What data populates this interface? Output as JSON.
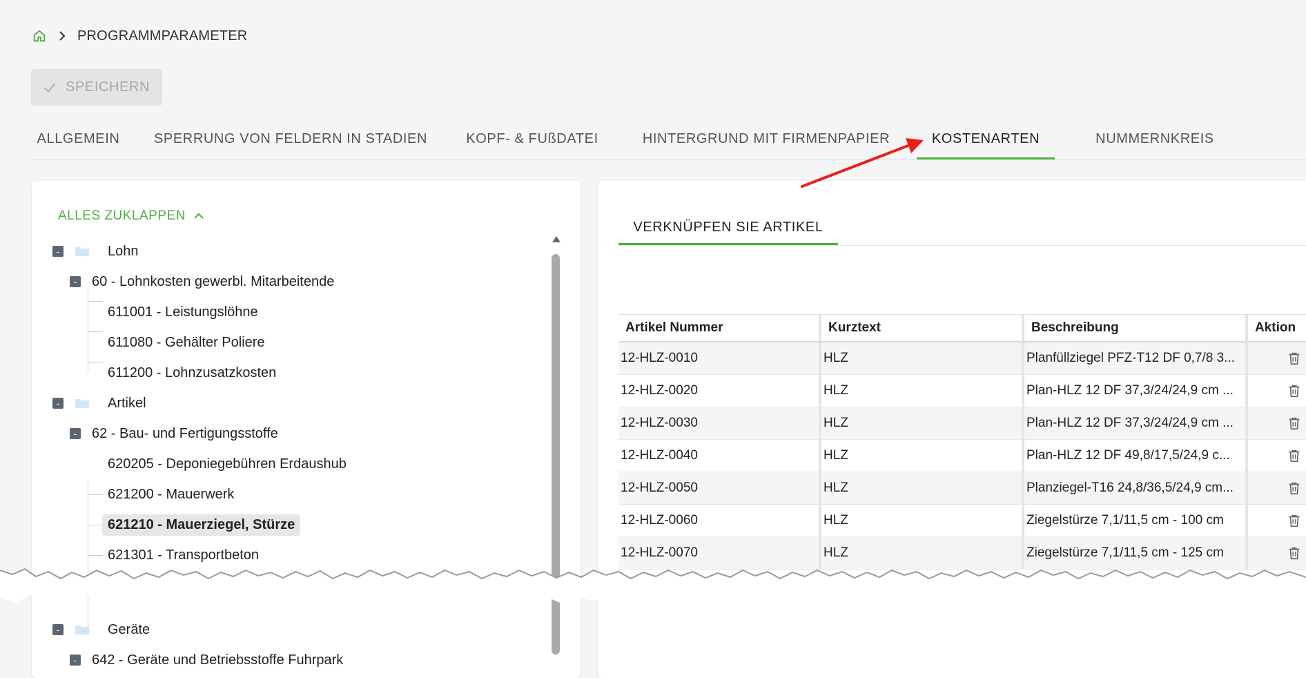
{
  "breadcrumb": {
    "home_icon": "home-icon",
    "separator_icon": "chevron-right-icon",
    "current": "PROGRAMMPARAMETER"
  },
  "toolbar": {
    "save_label": "SPEICHERN",
    "save_icon": "check-icon"
  },
  "tabs": [
    {
      "label": "ALLGEMEIN",
      "active": false
    },
    {
      "label": "SPERRUNG VON FELDERN IN STADIEN",
      "active": false
    },
    {
      "label": "KOPF- & FUßDATEI",
      "active": false
    },
    {
      "label": "HINTERGRUND MIT FIRMENPAPIER",
      "active": false
    },
    {
      "label": "KOSTENARTEN",
      "active": true
    },
    {
      "label": "NUMMERNKREIS",
      "active": false
    }
  ],
  "annotation": {
    "arrow_color": "#e8201c"
  },
  "tree_panel": {
    "collapse_all_label": "ALLES ZUKLAPPEN",
    "toggle_symbol": "-",
    "nodes": [
      {
        "level": 0,
        "label": "Lohn",
        "type": "folder"
      },
      {
        "level": 1,
        "label": "60 - Lohnkosten gewerbl. Mitarbeitende",
        "type": "group"
      },
      {
        "level": 2,
        "label": "611001 - Leistungslöhne",
        "type": "leaf"
      },
      {
        "level": 2,
        "label": "611080 - Gehälter Poliere",
        "type": "leaf"
      },
      {
        "level": 2,
        "label": "611200 - Lohnzusatzkosten",
        "type": "leaf"
      },
      {
        "level": 0,
        "label": "Artikel",
        "type": "folder"
      },
      {
        "level": 1,
        "label": "62 - Bau- und Fertigungsstoffe",
        "type": "group"
      },
      {
        "level": 2,
        "label": "620205 - Deponiegebühren Erdaushub",
        "type": "leaf"
      },
      {
        "level": 2,
        "label": "621200 - Mauerwerk",
        "type": "leaf"
      },
      {
        "level": 2,
        "label": "621210 - Mauerziegel, Stürze",
        "type": "leaf",
        "selected": true
      },
      {
        "level": 2,
        "label": "621301 - Transportbeton",
        "type": "leaf"
      },
      {
        "level": 0,
        "label": "Geräte",
        "type": "folder"
      },
      {
        "level": 1,
        "label": "642 - Geräte und Betriebsstoffe Fuhrpark",
        "type": "group"
      }
    ]
  },
  "articles_panel": {
    "subtab_label": "VERKNÜPFEN SIE ARTIKEL",
    "columns": [
      "Artikel Nummer",
      "Kurztext",
      "Beschreibung",
      "Aktion"
    ],
    "rows": [
      {
        "nummer": "12-HLZ-0010",
        "kurztext": "HLZ",
        "beschreibung": "Planfüllziegel PFZ-T12 DF 0,7/8 3..."
      },
      {
        "nummer": "12-HLZ-0020",
        "kurztext": "HLZ",
        "beschreibung": "Plan-HLZ 12 DF 37,3/24/24,9 cm ..."
      },
      {
        "nummer": "12-HLZ-0030",
        "kurztext": "HLZ",
        "beschreibung": "Plan-HLZ 12 DF 37,3/24/24,9 cm ..."
      },
      {
        "nummer": "12-HLZ-0040",
        "kurztext": "HLZ",
        "beschreibung": "Plan-HLZ 12 DF 49,8/17,5/24,9 c..."
      },
      {
        "nummer": "12-HLZ-0050",
        "kurztext": "HLZ",
        "beschreibung": "Planziegel-T16 24,8/36,5/24,9 cm..."
      },
      {
        "nummer": "12-HLZ-0060",
        "kurztext": "HLZ",
        "beschreibung": "Ziegelstürze 7,1/11,5 cm - 100 cm"
      },
      {
        "nummer": "12-HLZ-0070",
        "kurztext": "HLZ",
        "beschreibung": "Ziegelstürze 7,1/11,5 cm - 125 cm"
      }
    ],
    "action_icon": "trash-icon"
  },
  "colors": {
    "accent": "#4cae3d",
    "background": "#f5f5f5",
    "panel": "#ffffff"
  }
}
